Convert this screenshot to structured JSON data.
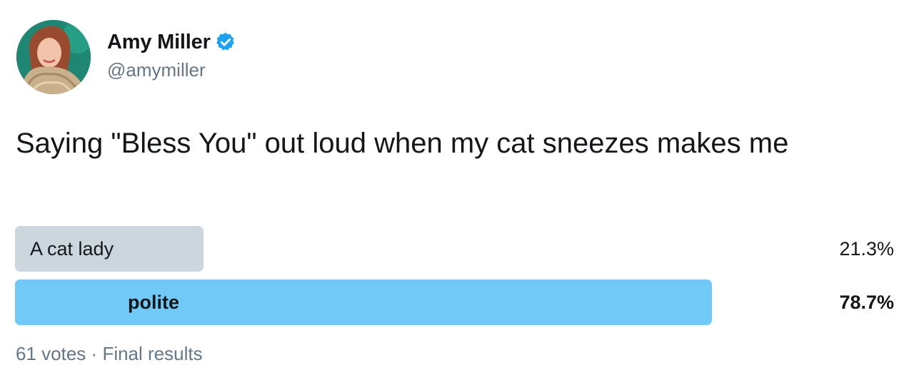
{
  "author": {
    "display_name": "Amy Miller",
    "handle": "@amymiller",
    "verified": true,
    "verified_icon": "verified-badge-icon",
    "verified_color": "#1da1f2",
    "avatar_icon": "profile-photo"
  },
  "tweet": {
    "text": "Saying \"Bless You\" out loud when my cat sneezes makes me"
  },
  "poll": {
    "options": [
      {
        "label": "A cat lady",
        "percent_text": "21.3%",
        "percent": 21.3,
        "winner": false,
        "bar_color": "#ccd6dd"
      },
      {
        "label": "polite",
        "percent_text": "78.7%",
        "percent": 78.7,
        "winner": true,
        "bar_color": "#71c9f8"
      }
    ],
    "votes": "61 votes",
    "separator": "·",
    "status": "Final results"
  },
  "colors": {
    "text_primary": "#14171a",
    "text_secondary": "#657786"
  }
}
